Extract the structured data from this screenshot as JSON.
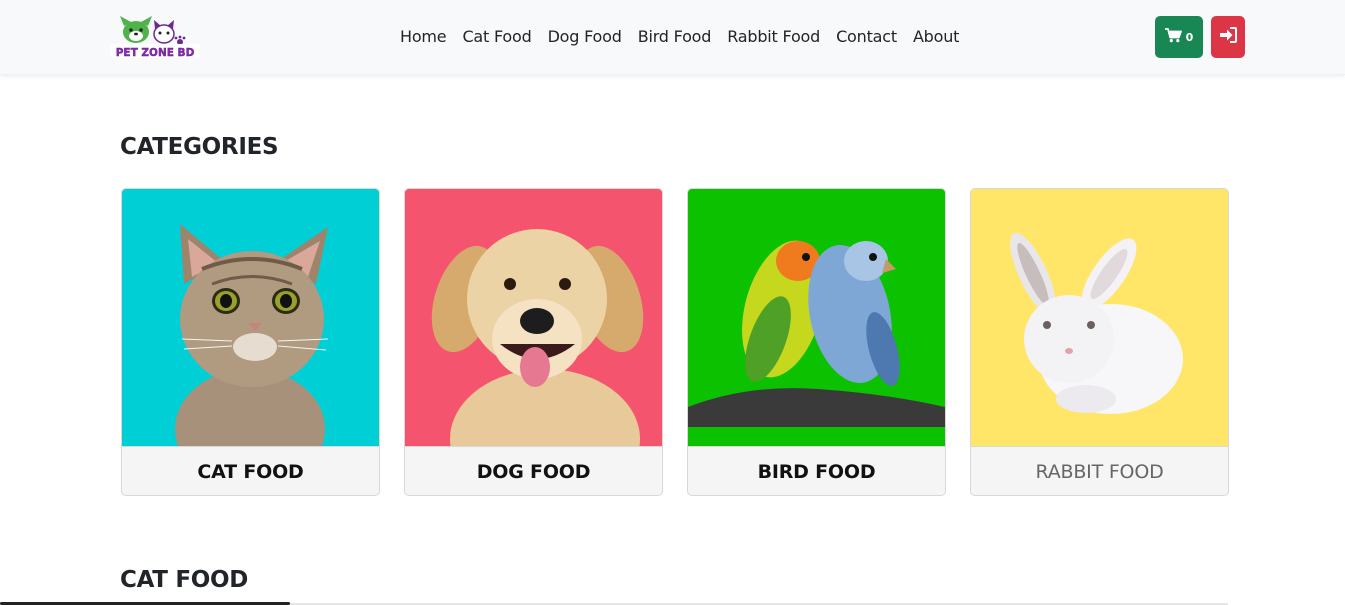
{
  "brand": {
    "logo_text": "PET ZONE BD"
  },
  "nav": {
    "links": [
      "Home",
      "Cat Food",
      "Dog Food",
      "Bird Food",
      "Rabbit Food",
      "Contact",
      "About"
    ]
  },
  "cart": {
    "count": "0",
    "icon": "shopping-cart-icon"
  },
  "login": {
    "icon": "sign-in-icon"
  },
  "colors": {
    "cart_button": "#198754",
    "login_button": "#dc3545",
    "cat_bg": "#00cfd5",
    "dog_bg": "#f5546e",
    "bird_bg": "#0cc100",
    "rabbit_bg": "#ffe568"
  },
  "categories": {
    "title": "CATEGORIES",
    "items": [
      {
        "label": "CAT FOOD"
      },
      {
        "label": "DOG FOOD"
      },
      {
        "label": "BIRD FOOD"
      },
      {
        "label": "RABBIT FOOD"
      }
    ]
  },
  "cat_food_section": {
    "title": "CAT FOOD"
  }
}
